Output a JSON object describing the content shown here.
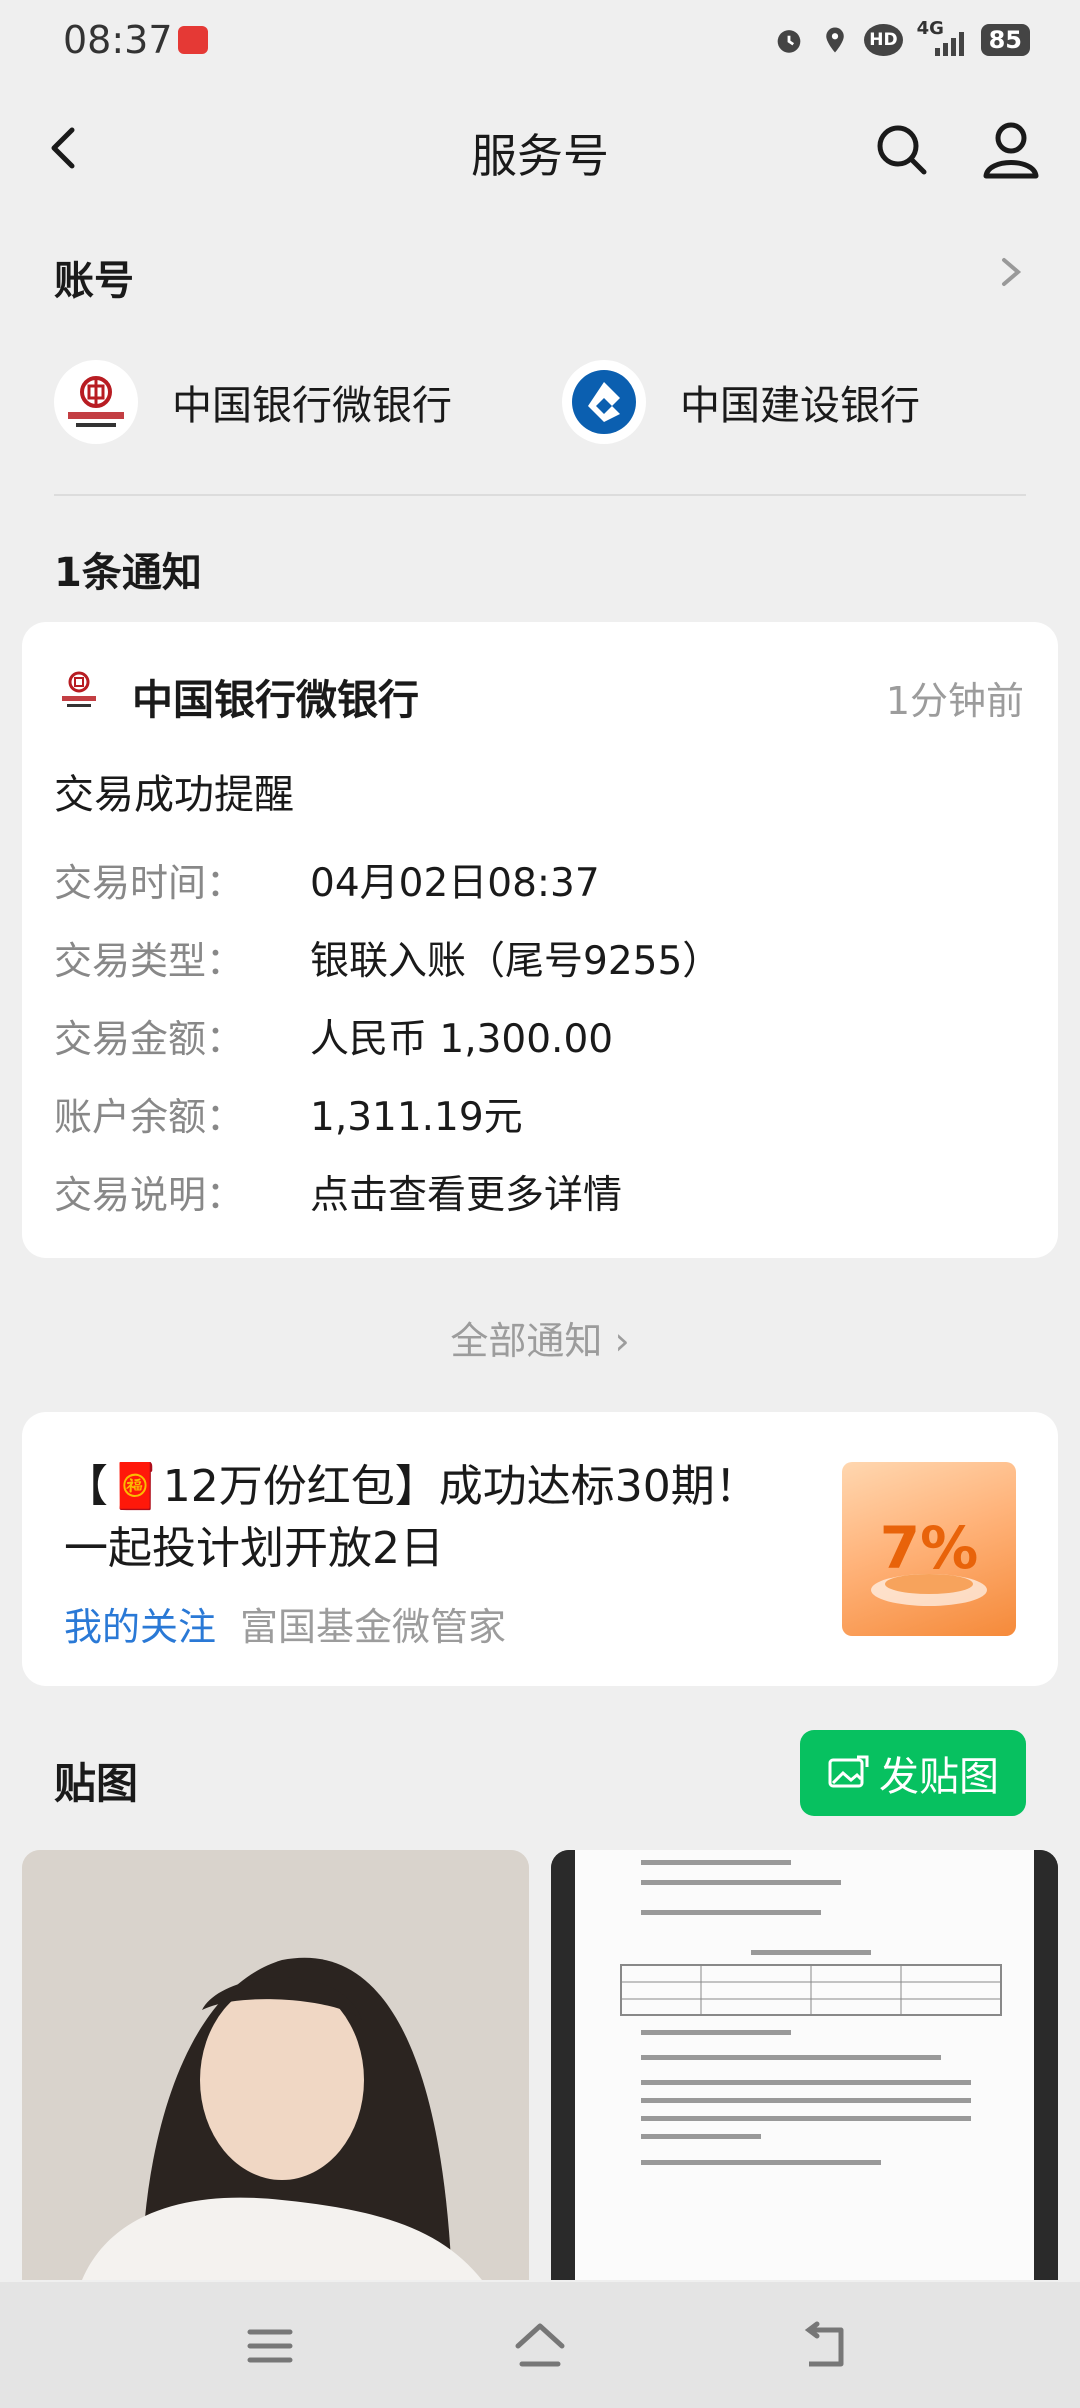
{
  "status_bar": {
    "time": "08:37",
    "network": "4G",
    "hd": "HD",
    "battery": "85",
    "icons": [
      "alarm-icon",
      "location-icon",
      "hd-icon",
      "signal-icon",
      "battery-icon"
    ]
  },
  "header": {
    "title": "服务号",
    "back_icon": "chevron-left-icon",
    "search_icon": "search-icon",
    "profile_icon": "person-icon"
  },
  "accounts": {
    "title": "账号",
    "items": [
      {
        "name": "中国银行微银行",
        "logo": "bank-of-china-logo"
      },
      {
        "name": "中国建设银行",
        "logo": "ccb-logo"
      }
    ]
  },
  "notices": {
    "count_label": "1条通知",
    "card": {
      "sender": "中国银行微银行",
      "time": "1分钟前",
      "title": "交易成功提醒",
      "rows": [
        {
          "label": "交易时间：",
          "value": "04月02日08:37"
        },
        {
          "label": "交易类型：",
          "value": "银联入账（尾号9255）"
        },
        {
          "label": "交易金额：",
          "value": "人民币 1,300.00"
        },
        {
          "label": "账户余额：",
          "value": "1,311.19元"
        },
        {
          "label": "交易说明：",
          "value": "点击查看更多详情"
        }
      ]
    },
    "all_label": "全部通知 ›"
  },
  "promo": {
    "text": "【🧧12万份红包】成功达标30期！一起投计划开放2日",
    "follow_label": "我的关注",
    "source": "富国基金微管家",
    "thumb_text": "7%"
  },
  "posts": {
    "title": "贴图",
    "button_label": "发贴图"
  },
  "navbar": {
    "items": [
      "menu-icon",
      "home-icon",
      "back-icon"
    ]
  },
  "colors": {
    "background": "#efefef",
    "accent_green": "#07c160",
    "link_blue": "#2a79d6",
    "boc_red": "#b81c22",
    "ccb_blue": "#0b5fb0"
  }
}
